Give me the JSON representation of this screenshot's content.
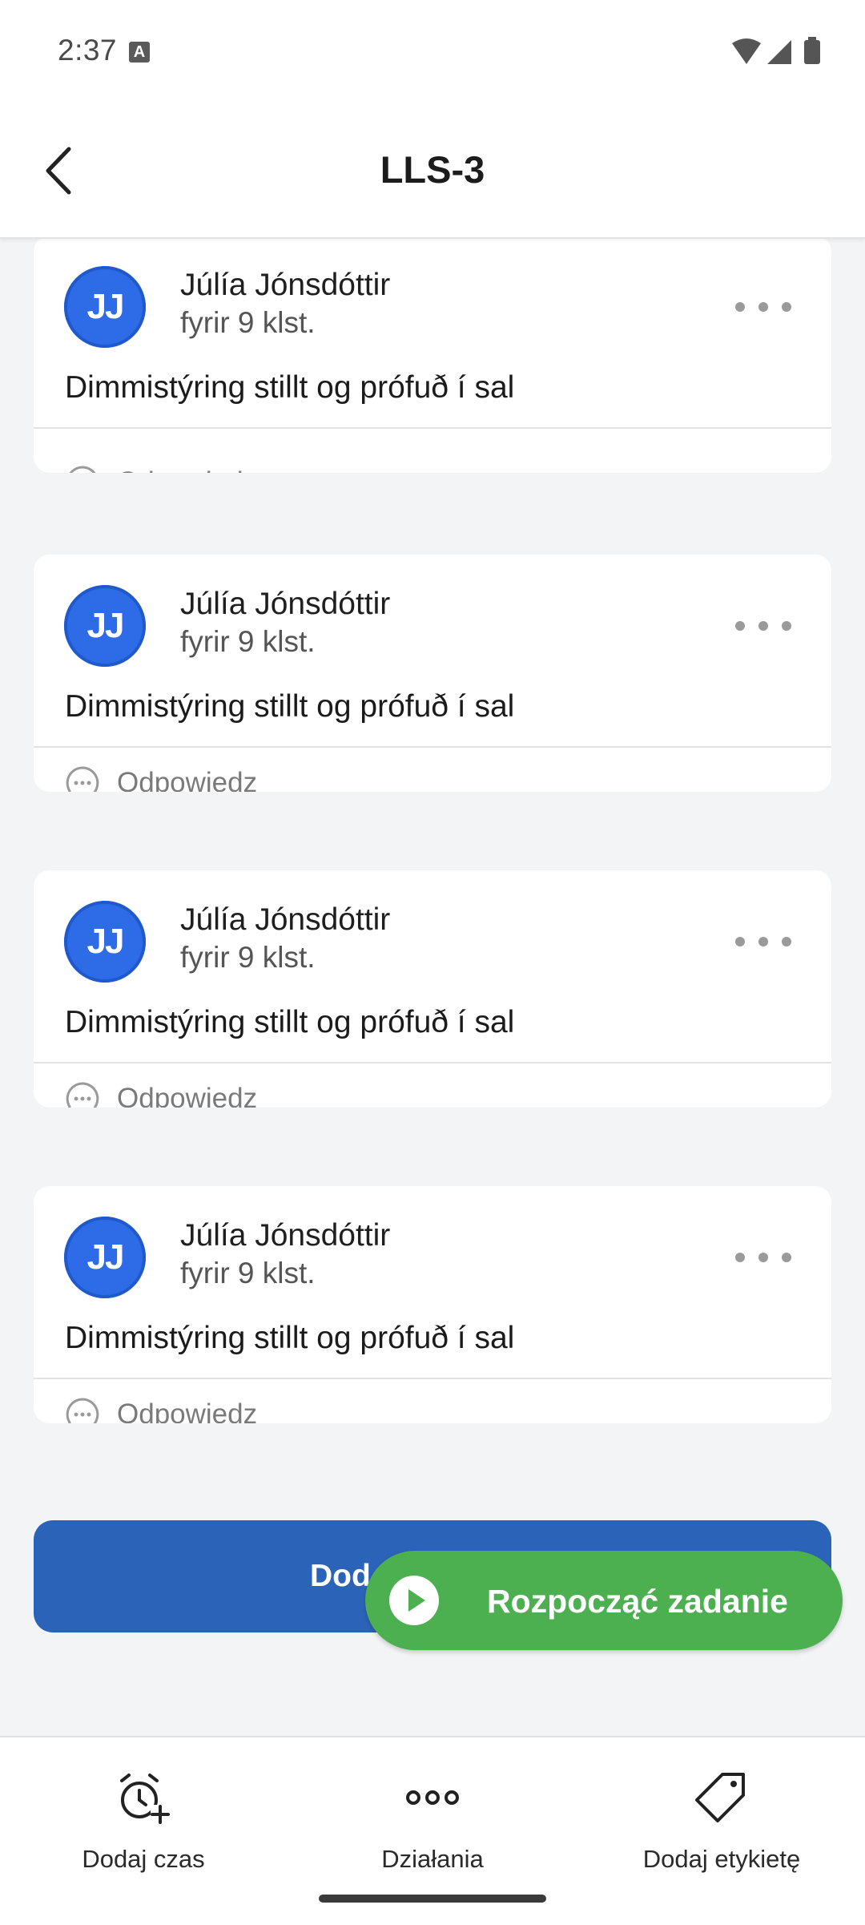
{
  "status_bar": {
    "time": "2:37",
    "notification_letter": "A"
  },
  "app_bar": {
    "title": "LLS-3"
  },
  "comments": [
    {
      "initials": "JJ",
      "author": "Júlía Jónsdóttir",
      "time": "fyrir 9 klst.",
      "text": "Dimmistýring stillt og prófuð í sal",
      "reply_label": "Odpowiedz"
    },
    {
      "initials": "JJ",
      "author": "Júlía Jónsdóttir",
      "time": "fyrir 9 klst.",
      "text": "Dimmistýring stillt og prófuð í sal",
      "reply_label": "Odpowiedz"
    },
    {
      "initials": "JJ",
      "author": "Júlía Jónsdóttir",
      "time": "fyrir 9 klst.",
      "text": "Dimmistýring stillt og prófuð í sal",
      "reply_label": "Odpowiedz"
    },
    {
      "initials": "JJ",
      "author": "Júlía Jónsdóttir",
      "time": "fyrir 9 klst.",
      "text": "Dimmistýring stillt og prófuð í sal",
      "reply_label": "Odpowiedz"
    }
  ],
  "add_button": {
    "label_visible": "Dod"
  },
  "fab": {
    "label": "Rozpocząć zadanie",
    "icon": "play-icon"
  },
  "bottom_nav": [
    {
      "label": "Dodaj czas",
      "icon": "clock-add-icon"
    },
    {
      "label": "Działania",
      "icon": "more-horizontal-icon"
    },
    {
      "label": "Dodaj etykietę",
      "icon": "tag-icon"
    }
  ],
  "colors": {
    "avatar": "#2e6be6",
    "add_button": "#2b63b8",
    "fab": "#4caf50",
    "background": "#f3f4f6"
  }
}
